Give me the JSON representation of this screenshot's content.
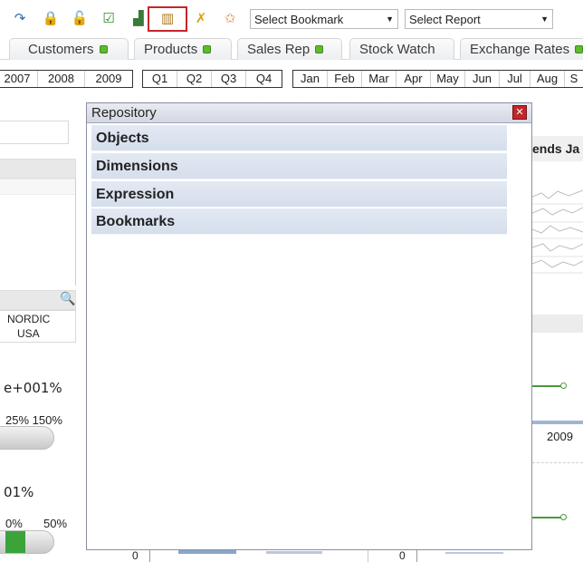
{
  "toolbar": {
    "icons": [
      "redo-icon",
      "lock-icon",
      "unlock-icon",
      "checkbox-icon",
      "chart-wizard-icon",
      "repository-icon",
      "pin-icon",
      "star-icon"
    ],
    "bookmark_select": "Select Bookmark",
    "report_select": "Select Report"
  },
  "tabs": [
    {
      "label": "Customers"
    },
    {
      "label": "Products"
    },
    {
      "label": "Sales Rep"
    },
    {
      "label": "Stock Watch"
    },
    {
      "label": "Exchange Rates"
    }
  ],
  "years": [
    "2007",
    "2008",
    "2009"
  ],
  "quarters": [
    "Q1",
    "Q2",
    "Q3",
    "Q4"
  ],
  "months": [
    "Jan",
    "Feb",
    "Mar",
    "Apr",
    "May",
    "Jun",
    "Jul",
    "Aug",
    "S"
  ],
  "background": {
    "trends_title": "ends Ja",
    "list_values": [
      "NORDIC",
      "USA"
    ],
    "gauge1_value": "e+001%",
    "gauge1_scale": "25% 150%",
    "gauge2_value": "01%",
    "gauge2_scale_left": "0%",
    "gauge2_scale_right": "50%",
    "chart_year": "2009",
    "axis_zero_left": "0",
    "axis_zero_right": "0"
  },
  "repository": {
    "title": "Repository",
    "close_label": "✕",
    "items": [
      "Objects",
      "Dimensions",
      "Expression",
      "Bookmarks"
    ]
  }
}
